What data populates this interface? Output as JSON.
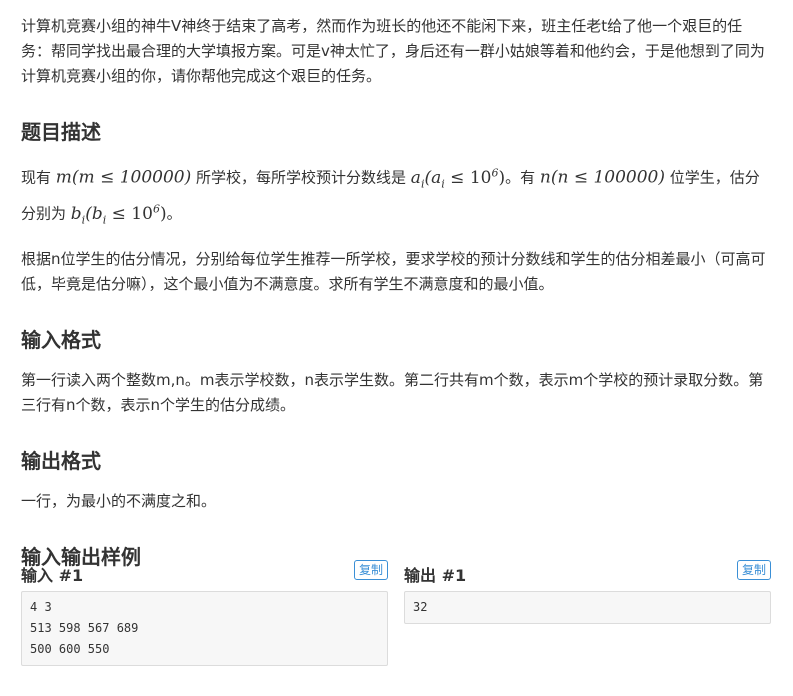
{
  "intro": {
    "text": "计算机竞赛小组的神牛V神终于结束了高考，然而作为班长的他还不能闲下来，班主任老t给了他一个艰巨的任务：帮同学找出最合理的大学填报方案。可是v神太忙了，身后还有一群小姑娘等着和他约会，于是他想到了同为计算机竞赛小组的你，请你帮他完成这个艰巨的任务。"
  },
  "description": {
    "heading": "题目描述",
    "p1_part1": "现有 ",
    "p1_part2": " 所学校，每所学校预计分数线是 ",
    "p1_part3": "。有 ",
    "p1_part4": " 位学生，估分分别为 ",
    "p1_part5": "。",
    "math_m_var": "m",
    "math_m_cond": "(m ≤ 100000)",
    "math_a_var": "a",
    "math_a_sub": "i",
    "math_a_cond_open": "(a",
    "math_a_cond_mid": " ≤ 10",
    "math_a_cond_exp": "6",
    "math_a_cond_close": ")",
    "math_n_var": "n",
    "math_n_cond": "(n ≤ 100000)",
    "math_b_var": "b",
    "math_b_sub": "i",
    "math_b_cond_open": "(b",
    "math_b_cond_mid": " ≤ 10",
    "math_b_cond_exp": "6",
    "math_b_cond_close": ")",
    "p2": "根据n位学生的估分情况，分别给每位学生推荐一所学校，要求学校的预计分数线和学生的估分相差最小（可高可低，毕竟是估分嘛），这个最小值为不满意度。求所有学生不满意度和的最小值。"
  },
  "input_format": {
    "heading": "输入格式",
    "text": "第一行读入两个整数m,n。m表示学校数，n表示学生数。第二行共有m个数，表示m个学校的预计录取分数。第三行有n个数，表示n个学生的估分成绩。"
  },
  "output_format": {
    "heading": "输出格式",
    "text": "一行，为最小的不满度之和。"
  },
  "samples": {
    "heading": "输入输出样例",
    "input_title": "输入 #1",
    "output_title": "输出 #1",
    "copy_label": "复制",
    "input_text": "4 3\n513 598 567 689\n500 600 550",
    "output_text": "32"
  }
}
